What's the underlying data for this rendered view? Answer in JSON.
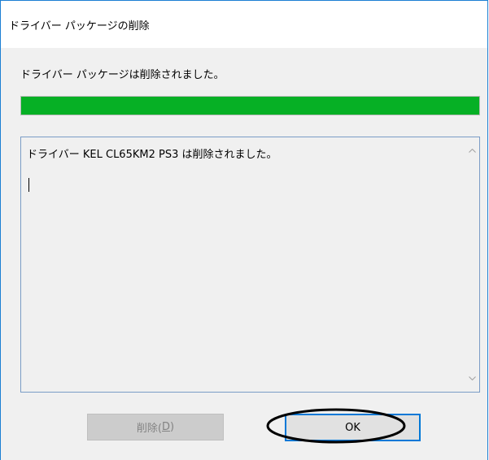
{
  "dialog": {
    "title": "ドライバー パッケージの削除",
    "status_message": "ドライバー パッケージは削除されました。",
    "progress_percent": 100,
    "log_lines": [
      "ドライバー KEL CL65KM2 PS3 は削除されました。"
    ]
  },
  "buttons": {
    "delete_label": "削除(",
    "delete_mnemonic": "D",
    "delete_suffix": ")",
    "delete_enabled": false,
    "ok_label": "OK"
  },
  "annotation": {
    "highlight_target": "ok-button",
    "highlight_color": "#000000"
  },
  "colors": {
    "progress_fill": "#06b025",
    "focus_border": "#0078d7",
    "window_border": "#1b7fd3"
  },
  "icons": {
    "scroll_up": "chevron-up-icon",
    "scroll_down": "chevron-down-icon"
  }
}
